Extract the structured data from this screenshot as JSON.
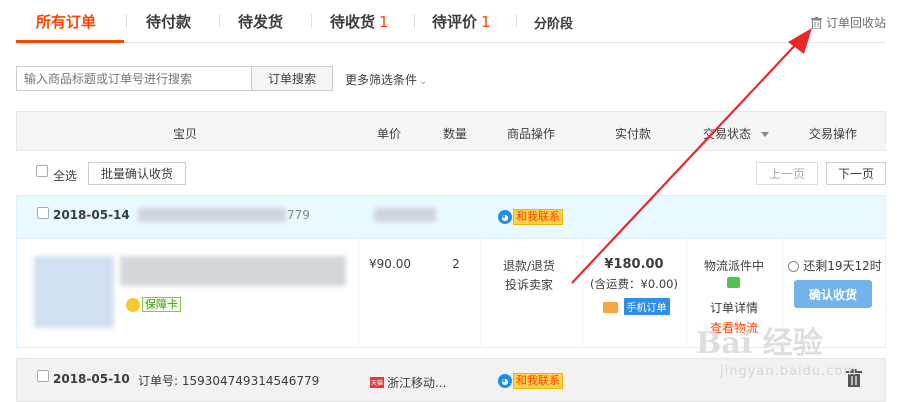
{
  "tabs": {
    "items": [
      {
        "label": "所有订单",
        "count": ""
      },
      {
        "label": "待付款",
        "count": ""
      },
      {
        "label": "待发货",
        "count": ""
      },
      {
        "label": "待收货",
        "count": "1"
      },
      {
        "label": "待评价",
        "count": "1"
      },
      {
        "label": "分阶段",
        "count": ""
      }
    ],
    "recycle_label": "订单回收站"
  },
  "search": {
    "placeholder": "输入商品标题或订单号进行搜索",
    "button_label": "订单搜索",
    "more_filters_label": "更多筛选条件"
  },
  "table_header": {
    "item": "宝贝",
    "unit_price": "单价",
    "quantity": "数量",
    "item_ops": "商品操作",
    "paid": "实付款",
    "status": "交易状态",
    "order_ops": "交易操作"
  },
  "toolbar": {
    "select_all_label": "全选",
    "bulk_confirm_label": "批量确认收货",
    "prev_label": "上一页",
    "next_label": "下一页"
  },
  "orders": [
    {
      "date": "2018-05-14",
      "order_no_fragment": "779",
      "contact_label": "和我联系",
      "guarantee_label": "保障卡",
      "unit_price": "¥90.00",
      "quantity": "2",
      "ops": [
        "退款/退货",
        "投诉卖家"
      ],
      "paid": "¥180.00",
      "shipping_note": "(含运费：¥0.00)",
      "mobile_order_label": "手机订单",
      "status": "物流派件中",
      "detail_label": "订单详情",
      "logistics_label": "查看物流",
      "remaining": "还剩19天12时",
      "confirm_label": "确认收货"
    },
    {
      "date": "2018-05-10",
      "order_no": "订单号: 159304749314546779",
      "shop_name": "浙江移动...",
      "contact_label": "和我联系",
      "shop_icon_text": "天猫"
    }
  ],
  "watermark": {
    "text": "Bai 经验",
    "sub": "jingyan.baidu.com"
  },
  "colors": {
    "accent": "#ff4400",
    "arrow": "#e8282b",
    "confirm_button": "#71b3ea",
    "order_header_bg": "#eaf8ff"
  }
}
